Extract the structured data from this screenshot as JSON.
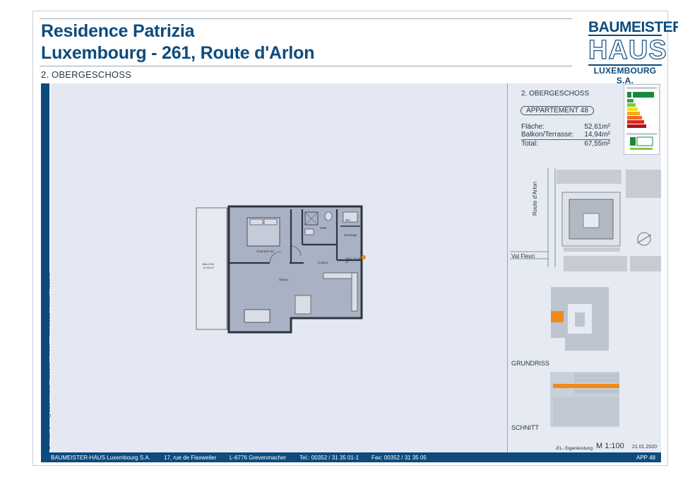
{
  "header": {
    "title_line1": "Residence Patrizia",
    "title_line2": "Luxembourg - 261, Route d'Arlon",
    "floor": "2. OBERGESCHOSS"
  },
  "logo": {
    "line1": "BAUMEISTER",
    "line2": "HAUS",
    "line3": "LUXEMBOURG S.A."
  },
  "side_strip": {
    "email": "E-Mail: bmh@baumeister-haus.lu",
    "info": "Info:",
    "web": "www.baumeister-haus.lu"
  },
  "right_panel": {
    "floor": "2. OBERGESCHOSS",
    "apartment": "APPARTEMENT 48",
    "areas": [
      {
        "label": "Fläche:",
        "value": "52,61m²"
      },
      {
        "label": "Balkon/Terrasse:",
        "value": "14,94m²"
      },
      {
        "label": "Total:",
        "value": "67,55m²"
      }
    ],
    "site_labels": {
      "street": "Route d'Arlon",
      "val_fleuri": "Val Fleuri"
    },
    "grundriss": "GRUNDRISS",
    "schnitt": "SCHNITT",
    "eigenleistung": "-EL- Eigenleistung",
    "scale": "M 1:100",
    "date": "21.01.2020",
    "app": "APP 48"
  },
  "plan": {
    "rooms": {
      "chambre": "Chambre 01",
      "sdb": "SDB",
      "stockage": "Stockage",
      "wc": "WC",
      "couloir": "Couloir",
      "sejour": "Séjour",
      "entree": "HALL 22.48 m²",
      "balcon": "BALCON 14.94 m²"
    }
  },
  "footer": {
    "company": "BAUMEISTER-HAUS Luxembourg S.A.",
    "street": "17, rue de Flaxweiler",
    "city": "L-6776 Grevenmacher",
    "tel": "Tel.: 00352 / 31 35 01-1",
    "fax": "Fax: 00352 / 31 35 05"
  },
  "colors": {
    "brand_blue": "#0d4b7d",
    "plan_background": "#e3e8f2",
    "apartment_fill": "#a9b1c4",
    "highlight_orange": "#f08a1c"
  }
}
